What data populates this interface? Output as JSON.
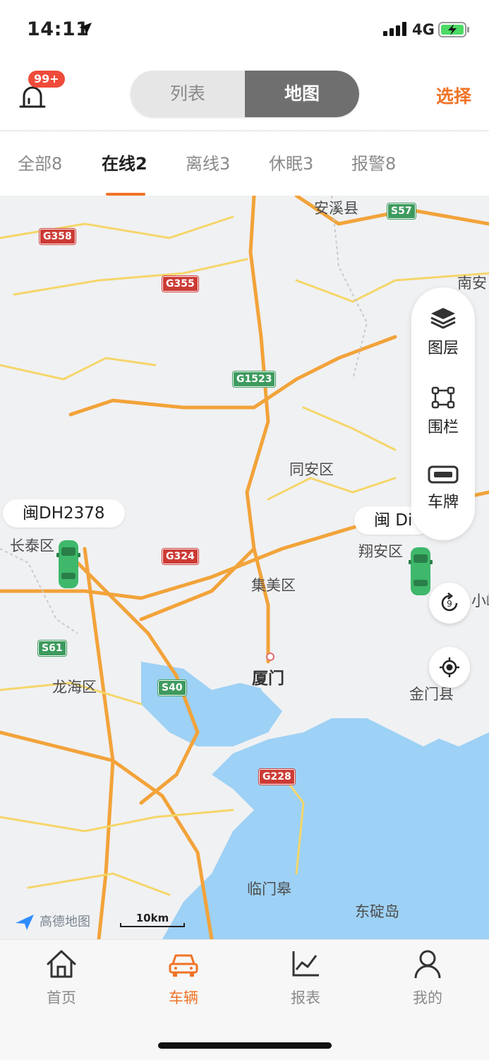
{
  "status_bar": {
    "time": "14:11",
    "network": "4G"
  },
  "header": {
    "alarm_badge": "99+",
    "segment": {
      "list_label": "列表",
      "map_label": "地图",
      "active": "地图"
    },
    "select_label": "选择"
  },
  "filter_tabs": [
    {
      "label": "全部8",
      "active": false
    },
    {
      "label": "在线2",
      "active": true
    },
    {
      "label": "离线3",
      "active": false
    },
    {
      "label": "休眠3",
      "active": false
    },
    {
      "label": "报警8",
      "active": false
    }
  ],
  "map": {
    "places": [
      "安溪县",
      "南安",
      "同安区",
      "长泰区",
      "翔安区",
      "集美区",
      "厦门",
      "龙海区",
      "金门县",
      "小嶝",
      "临门皋",
      "东碇岛"
    ],
    "road_shields": [
      "G358",
      "G355",
      "G1523",
      "G324",
      "S61",
      "S40",
      "G228",
      "S57"
    ],
    "vehicles": [
      {
        "plate": "闽DH2378",
        "color": "#3fb86b"
      },
      {
        "plate": "闽 Di",
        "color": "#3fb86b"
      }
    ],
    "side_panel": {
      "layers_label": "图层",
      "fence_label": "围栏",
      "plate_label": "车牌"
    },
    "provider": "高德地图",
    "scale": "10km",
    "water_color": "#9dd1f5",
    "land_color": "#f0f1f3"
  },
  "bottom_nav": [
    {
      "label": "首页",
      "icon": "home-icon",
      "active": false
    },
    {
      "label": "车辆",
      "icon": "car-icon",
      "active": true
    },
    {
      "label": "报表",
      "icon": "chart-icon",
      "active": false
    },
    {
      "label": "我的",
      "icon": "user-icon",
      "active": false
    }
  ],
  "accent_color": "#f07326"
}
